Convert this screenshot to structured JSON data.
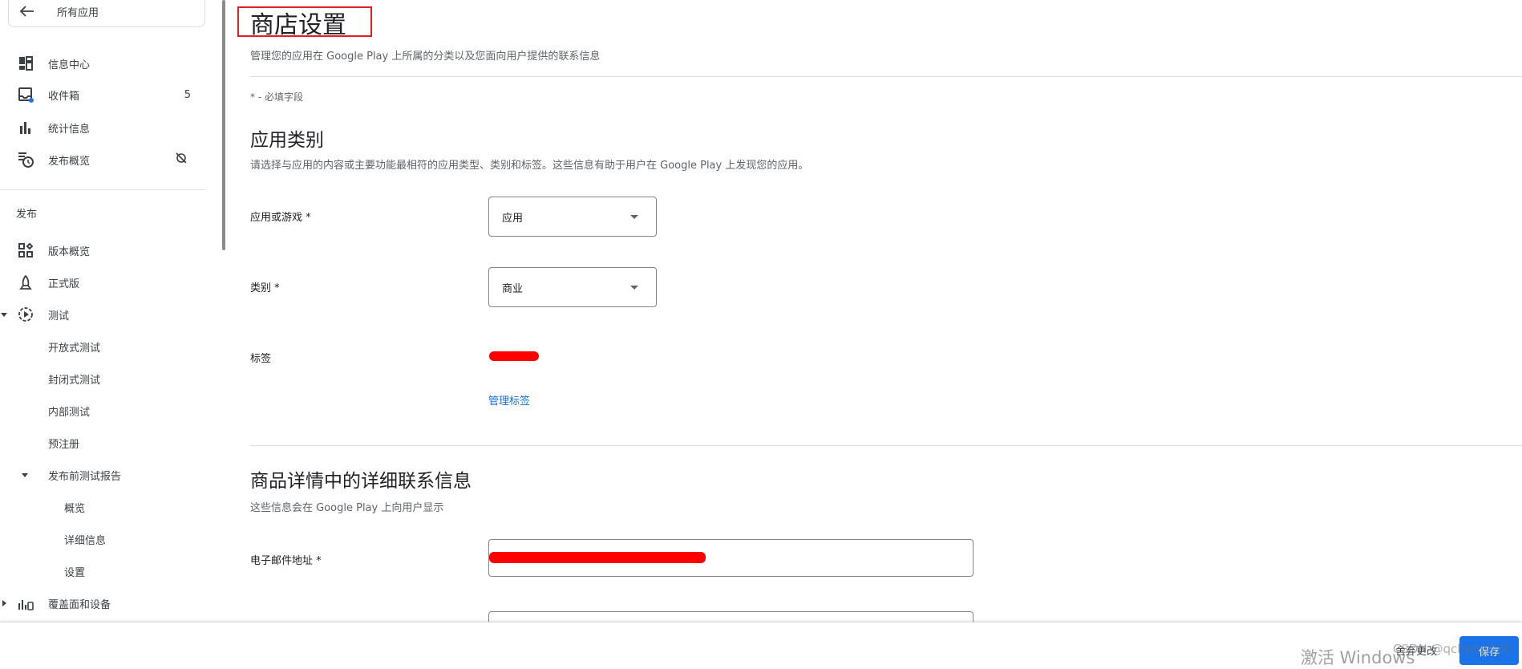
{
  "sidebar": {
    "back_label": "所有应用",
    "top_items": [
      {
        "label": "信息中心",
        "icon": "dashboard-icon"
      },
      {
        "label": "收件箱",
        "icon": "inbox-icon",
        "badge": "5"
      },
      {
        "label": "统计信息",
        "icon": "bar-chart-icon"
      },
      {
        "label": "发布概览",
        "icon": "publishing-overview-icon"
      }
    ],
    "section_release": "发布",
    "release_items": [
      {
        "label": "版本概览",
        "icon": "releases-overview-icon"
      },
      {
        "label": "正式版",
        "icon": "production-icon"
      },
      {
        "label": "测试",
        "icon": "testing-icon"
      },
      {
        "label": "开放式测试"
      },
      {
        "label": "封闭式测试"
      },
      {
        "label": "内部测试"
      },
      {
        "label": "预注册"
      },
      {
        "label": "发布前测试报告"
      },
      {
        "label": "概览"
      },
      {
        "label": "详细信息"
      },
      {
        "label": "设置"
      },
      {
        "label": "覆盖面和设备",
        "icon": "reach-devices-icon"
      }
    ]
  },
  "main": {
    "title": "商店设置",
    "subtitle": "管理您的应用在 Google Play 上所属的分类以及您面向用户提供的联系信息",
    "required_note": "* - 必填字段",
    "app_category": {
      "title": "应用类别",
      "desc": "请选择与应用的内容或主要功能最相符的应用类型、类别和标签。这些信息有助于用户在 Google Play 上发现您的应用。",
      "app_or_game_label": "应用或游戏 *",
      "app_or_game_value": "应用",
      "category_label": "类别 *",
      "category_value": "商业",
      "tags_label": "标签",
      "manage_tags": "管理标签"
    },
    "contact": {
      "title": "商品详情中的详细联系信息",
      "desc": "这些信息会在 Google Play 上向用户显示",
      "email_label": "电子邮件地址 *"
    }
  },
  "footer": {
    "discard_label": "舍弃更改",
    "save_label": "保存"
  },
  "overlay": {
    "watermark": "激活 Windows",
    "csdn": "CSDN @qcheng320"
  },
  "colors": {
    "accent": "#1a73e8",
    "highlight_box": "#e02020",
    "redaction": "#ff0000"
  }
}
